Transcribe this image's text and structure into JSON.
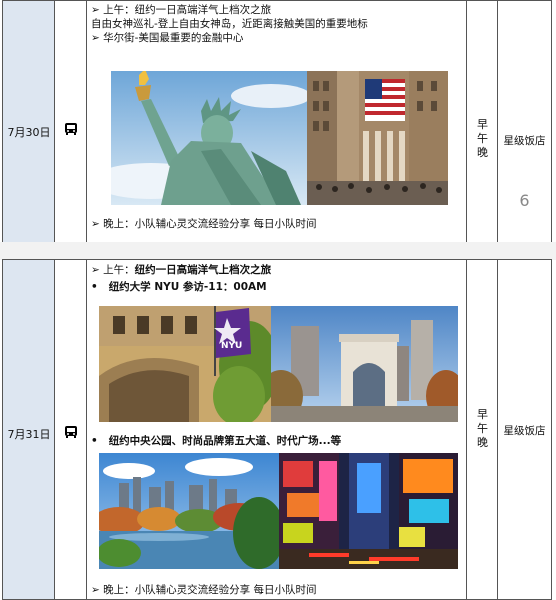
{
  "days": [
    {
      "date": "7月30日",
      "transport_icon": "bus-icon",
      "lines": [
        "➢ 上午：纽约一日高端洋气上档次之旅",
        "自由女神巡礼-登上自由女神岛，近距离接触美国的重要地标",
        "➢ 华尔街-美国最重要的金融中心"
      ],
      "evening": "➢ 晚上：小队辅心灵交流经验分享 每日小队时间",
      "meals": [
        "早",
        "午",
        "晚"
      ],
      "hotel": "星级饭店",
      "page_number": "6"
    },
    {
      "date": "7月31日",
      "transport_icon": "bus-icon",
      "morning_prefix": "➢ 上午：",
      "morning_title": "纽约一日高端洋气上档次之旅",
      "bullet1": "纽约大学 NYU 参访-11：00AM",
      "bullet2": "纽约中央公园、时尚品牌第五大道、时代广场...等",
      "evening": "➢ 晚上：小队辅心灵交流经验分享 每日小队时间",
      "meals": [
        "早",
        "午",
        "晚"
      ],
      "hotel": "星级饭店",
      "nyu_logo_text": "NYU"
    }
  ],
  "bullet_symbol": "•"
}
